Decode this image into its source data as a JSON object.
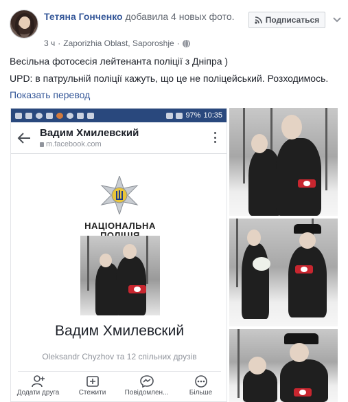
{
  "post": {
    "author": "Тетяна Гонченко",
    "action": "добавила 4 новых фото.",
    "time": "3 ч",
    "separator": "·",
    "location": "Zaporizhia Oblast, Saporoshje",
    "subscribe_label": "Подписаться",
    "text_line1": "Весільна фотосесія лейтенанта поліції з Дніпра )",
    "text_line2": "UPD: в патрульній поліції кажуть, що це не поліцейський. Розходимось.",
    "translate_link": "Показать перевод"
  },
  "phone": {
    "battery": "97%",
    "clock": "10:35",
    "profile_title": "Вадим Хмилевский",
    "url": "m.facebook.com",
    "logo_text_line1": "НАЦІОНАЛЬНА",
    "logo_text_line2": "ПОЛІЦІЯ",
    "full_name": "Вадим Хмилевский",
    "mutual_friends": "Oleksandr Chyzhov та 12 спільних друзів",
    "actions": [
      {
        "label": "Додати друга",
        "icon": "add-friend-icon"
      },
      {
        "label": "Стежити",
        "icon": "follow-icon"
      },
      {
        "label": "Повідомлен...",
        "icon": "messenger-icon"
      },
      {
        "label": "Більше",
        "icon": "more-icon"
      }
    ]
  },
  "colors": {
    "link": "#365899",
    "status_bar": "#29487d",
    "meta_text": "#616770"
  }
}
